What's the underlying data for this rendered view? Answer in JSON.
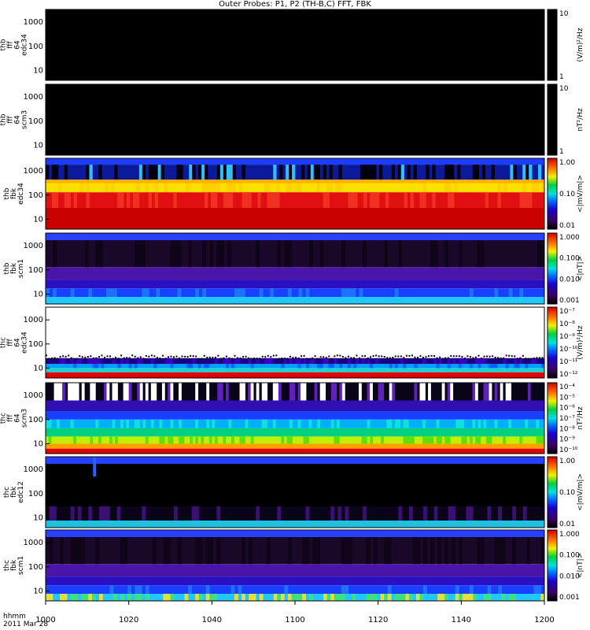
{
  "title": "Outer Probes: P1, P2 (TH-B,C) FFT, FBK",
  "time_axis": {
    "corner_labels": [
      "hhmm",
      "2011 Mar 28"
    ],
    "ticks": [
      "1000",
      "1020",
      "1040",
      "1100",
      "1120",
      "1140",
      "1200"
    ]
  },
  "chart_data": [
    {
      "type": "heatmap",
      "ylabel": [
        "thb",
        "fff",
        "64",
        "edc34"
      ],
      "yticks": [
        "1000",
        "100",
        "10"
      ],
      "ylim": [
        8,
        2000
      ],
      "yscale": "log",
      "colorbar": {
        "label": "(V/m)²/Hz",
        "ticks": [
          "10",
          "1"
        ],
        "palette": "rainbow"
      },
      "pattern": "blank"
    },
    {
      "type": "heatmap",
      "ylabel": [
        "thb",
        "fff",
        "64",
        "scm3"
      ],
      "yticks": [
        "1000",
        "100",
        "10"
      ],
      "ylim": [
        8,
        2000
      ],
      "yscale": "log",
      "colorbar": {
        "label": "nT²/Hz",
        "ticks": [
          "10",
          "1"
        ],
        "palette": "rainbow"
      },
      "pattern": "blank"
    },
    {
      "type": "heatmap",
      "ylabel": [
        "thb",
        "fbk",
        "edc34"
      ],
      "yticks": [
        "1000",
        "100",
        "10"
      ],
      "ylim": [
        2,
        2000
      ],
      "yscale": "log",
      "colorbar": {
        "label": "<|mV/m|>",
        "ticks": [
          "1.00",
          "0.10",
          "0.01"
        ],
        "palette": "rainbow"
      },
      "pattern": "efbk"
    },
    {
      "type": "heatmap",
      "ylabel": [
        "thb",
        "fbk",
        "scm1"
      ],
      "yticks": [
        "1000",
        "100",
        "10"
      ],
      "ylim": [
        2,
        2000
      ],
      "yscale": "log",
      "colorbar": {
        "label": "<|nT|>",
        "ticks": [
          "1.000",
          "0.100",
          "0.010",
          "0.001"
        ],
        "palette": "rainbow"
      },
      "pattern": "sfbk"
    },
    {
      "type": "heatmap",
      "ylabel": [
        "thc",
        "fff",
        "64",
        "edc34"
      ],
      "yticks": [
        "1000",
        "100",
        "10"
      ],
      "ylim": [
        8,
        4000
      ],
      "yscale": "log",
      "colorbar": {
        "label": "(V/m)²/Hz",
        "ticks": [
          "10⁻⁷",
          "10⁻⁸",
          "10⁻⁹",
          "10⁻¹⁰",
          "10⁻¹¹",
          "10⁻¹²"
        ],
        "palette": "rainbow"
      },
      "pattern": "effft"
    },
    {
      "type": "heatmap",
      "ylabel": [
        "thc",
        "fff",
        "64",
        "scm3"
      ],
      "yticks": [
        "1000",
        "100",
        "10"
      ],
      "ylim": [
        8,
        4000
      ],
      "yscale": "log",
      "colorbar": {
        "label": "nT²/Hz",
        "ticks": [
          "10⁻⁴",
          "10⁻⁵",
          "10⁻⁶",
          "10⁻⁷",
          "10⁻⁸",
          "10⁻⁹",
          "10⁻¹⁰"
        ],
        "palette": "rainbow"
      },
      "pattern": "sfft"
    },
    {
      "type": "heatmap",
      "ylabel": [
        "thc",
        "fbk",
        "edc12"
      ],
      "yticks": [
        "1000",
        "100",
        "10"
      ],
      "ylim": [
        2,
        2000
      ],
      "yscale": "log",
      "colorbar": {
        "label": "<|mV/m|>",
        "ticks": [
          "1.00",
          "0.10",
          "0.01"
        ],
        "palette": "rainbow"
      },
      "pattern": "efbk2"
    },
    {
      "type": "heatmap",
      "ylabel": [
        "thc",
        "fbk",
        "scm1"
      ],
      "yticks": [
        "1000",
        "100",
        "10"
      ],
      "ylim": [
        2,
        2000
      ],
      "yscale": "log",
      "colorbar": {
        "label": "<|nT|>",
        "ticks": [
          "1.000",
          "0.100",
          "0.010",
          "0.001"
        ],
        "palette": "rainbow"
      },
      "pattern": "sfbk2"
    }
  ]
}
